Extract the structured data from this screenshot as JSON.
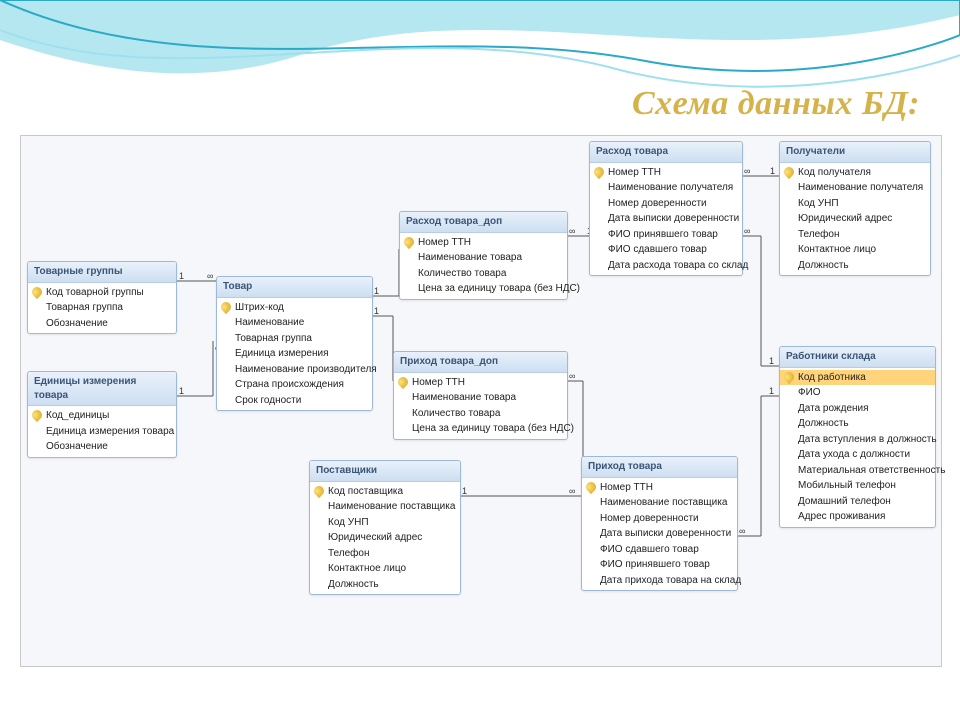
{
  "title": "Схема данных БД:",
  "tables": {
    "t1": {
      "title": "Товарные группы",
      "fields": [
        {
          "n": "Код товарной группы",
          "pk": true
        },
        {
          "n": "Товарная группа"
        },
        {
          "n": "Обозначение"
        }
      ]
    },
    "t2": {
      "title": "Единицы измерения товара",
      "fields": [
        {
          "n": "Код_единицы",
          "pk": true
        },
        {
          "n": "Единица измерения товара"
        },
        {
          "n": "Обозначение"
        }
      ]
    },
    "t3": {
      "title": "Товар",
      "fields": [
        {
          "n": "Штрих-код",
          "pk": true
        },
        {
          "n": "Наименование"
        },
        {
          "n": "Товарная группа"
        },
        {
          "n": "Единица измерения"
        },
        {
          "n": "Наименование производителя"
        },
        {
          "n": "Страна происхождения"
        },
        {
          "n": "Срок годности"
        }
      ]
    },
    "t4": {
      "title": "Расход товара_доп",
      "fields": [
        {
          "n": "Номер ТТН",
          "pk": true
        },
        {
          "n": "Наименование товара"
        },
        {
          "n": "Количество товара"
        },
        {
          "n": "Цена за единицу товара (без НДС)"
        }
      ]
    },
    "t5": {
      "title": "Приход товара_доп",
      "fields": [
        {
          "n": "Номер ТТН",
          "pk": true
        },
        {
          "n": "Наименование товара"
        },
        {
          "n": "Количество товара"
        },
        {
          "n": "Цена за единицу товара (без НДС)"
        }
      ]
    },
    "t6": {
      "title": "Поставщики",
      "fields": [
        {
          "n": "Код поставщика",
          "pk": true
        },
        {
          "n": "Наименование поставщика"
        },
        {
          "n": "Код УНП"
        },
        {
          "n": "Юридический адрес"
        },
        {
          "n": "Телефон"
        },
        {
          "n": "Контактное лицо"
        },
        {
          "n": "Должность"
        }
      ]
    },
    "t7": {
      "title": "Расход товара",
      "fields": [
        {
          "n": "Номер ТТН",
          "pk": true
        },
        {
          "n": "Наименование получателя"
        },
        {
          "n": "Номер доверенности"
        },
        {
          "n": "Дата выписки доверенности"
        },
        {
          "n": "ФИО принявшего товар"
        },
        {
          "n": "ФИО сдавшего товар"
        },
        {
          "n": "Дата расхода товара со склад"
        }
      ]
    },
    "t8": {
      "title": "Приход товара",
      "fields": [
        {
          "n": "Номер ТТН",
          "pk": true
        },
        {
          "n": "Наименование поставщика"
        },
        {
          "n": "Номер доверенности"
        },
        {
          "n": "Дата выписки доверенности"
        },
        {
          "n": "ФИО сдавшего товар"
        },
        {
          "n": "ФИО принявшего товар"
        },
        {
          "n": "Дата прихода товара на склад"
        }
      ]
    },
    "t9": {
      "title": "Получатели",
      "fields": [
        {
          "n": "Код получателя",
          "pk": true
        },
        {
          "n": "Наименование получателя"
        },
        {
          "n": "Код УНП"
        },
        {
          "n": "Юридический адрес"
        },
        {
          "n": "Телефон"
        },
        {
          "n": "Контактное лицо"
        },
        {
          "n": "Должность"
        }
      ]
    },
    "t10": {
      "title": "Работники склада",
      "fields": [
        {
          "n": "Код работника",
          "pk": true,
          "sel": true
        },
        {
          "n": "ФИО"
        },
        {
          "n": "Дата рождения"
        },
        {
          "n": "Должность"
        },
        {
          "n": "Дата вступления в должность"
        },
        {
          "n": "Дата ухода с должности"
        },
        {
          "n": "Материальная ответственность"
        },
        {
          "n": "Мобильный телефон"
        },
        {
          "n": "Домашний телефон"
        },
        {
          "n": "Адрес проживания"
        }
      ]
    }
  },
  "rel_labels": {
    "one": "1",
    "many": "∞"
  }
}
